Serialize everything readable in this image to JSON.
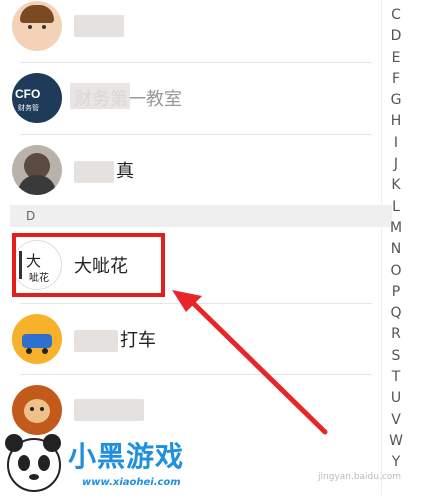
{
  "section_header": "D",
  "index_letters": [
    "C",
    "D",
    "E",
    "F",
    "G",
    "H",
    "I",
    "J",
    "K",
    "L",
    "M",
    "N",
    "O",
    "P",
    "Q",
    "R",
    "S",
    "T",
    "U",
    "V",
    "W",
    "Y"
  ],
  "contacts": [
    {
      "name_visible": "",
      "avatar": "cartoon-girl-avatar"
    },
    {
      "name_visible": "财务第一教室",
      "avatar": "cfo-logo-avatar",
      "avatar_text": "CFO",
      "avatar_subtext": "财务管"
    },
    {
      "name_visible": "真",
      "avatar": "person-avatar"
    },
    {
      "name_visible": "大呲花",
      "avatar": "dacihua-avatar",
      "avatar_text": "大",
      "avatar_subtext": "呲花"
    },
    {
      "name_visible": "打车",
      "avatar": "car-avatar"
    },
    {
      "name_visible": "",
      "avatar": "monkey-avatar"
    }
  ],
  "logo": {
    "brand": "小黑游戏",
    "url": "www.xiaohei.com"
  },
  "watermark": "jingyan.baidu.com",
  "colors": {
    "highlight": "#e41d1d",
    "arrow": "#e8262a",
    "logo_blue": "#1f8fe0"
  }
}
